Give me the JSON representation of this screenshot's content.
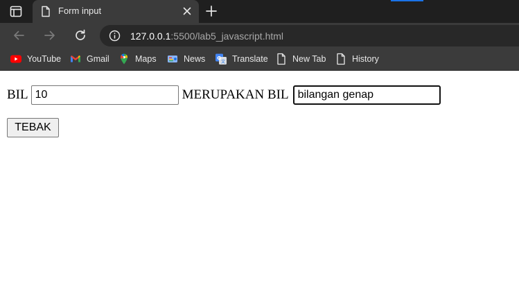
{
  "browser": {
    "tab": {
      "title": "Form input",
      "favicon_icon": "page-icon",
      "close_icon": "close-icon"
    },
    "new_tab_icon": "plus-icon",
    "nav": {
      "back_icon": "arrow-left-icon",
      "forward_icon": "arrow-right-icon",
      "reload_icon": "reload-icon"
    },
    "address_bar": {
      "info_icon": "info-icon",
      "host": "127.0.0.1",
      "path": ":5500/lab5_javascript.html"
    },
    "bookmarks": [
      {
        "label": "YouTube",
        "icon": "youtube-icon"
      },
      {
        "label": "Gmail",
        "icon": "gmail-icon"
      },
      {
        "label": "Maps",
        "icon": "maps-icon"
      },
      {
        "label": "News",
        "icon": "news-icon"
      },
      {
        "label": "Translate",
        "icon": "translate-icon"
      },
      {
        "label": "New Tab",
        "icon": "page-icon"
      },
      {
        "label": "History",
        "icon": "page-icon"
      }
    ],
    "colors": {
      "titlebar": "#1f1f1f",
      "toolbar": "#3b3b3b",
      "omnibox": "#282828",
      "accent": "#1a73e8"
    }
  },
  "form": {
    "label_bil": "BIL",
    "bil_value": "10",
    "label_merupakan": "MERUPAKAN BIL",
    "result_value": "bilangan genap",
    "button_label": "TEBAK"
  }
}
